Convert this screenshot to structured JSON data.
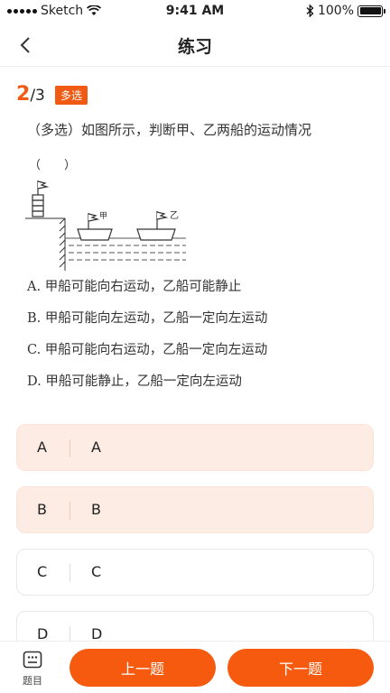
{
  "status_bar": {
    "carrier": "Sketch",
    "time": "9:41 AM",
    "battery": "100%"
  },
  "nav": {
    "title": "练习",
    "back_icon": "chevron-left-icon"
  },
  "question": {
    "current": "2",
    "separator": "/",
    "total": "3",
    "type_badge": "多选",
    "text": "（多选）如图所示，判断甲、乙两船的运动情况",
    "paren": "（　　）",
    "figure": {
      "boat_a_label": "甲",
      "boat_b_label": "乙"
    },
    "options": [
      "A.  甲船可能向右运动，乙船可能静止",
      "B.  甲船可能向左运动，乙船一定向左运动",
      "C.  甲船可能向右运动，乙船一定向左运动",
      "D.  甲船可能静止，乙船一定向左运动"
    ]
  },
  "answers": [
    {
      "letter": "A",
      "text": "A",
      "selected": true
    },
    {
      "letter": "B",
      "text": "B",
      "selected": true
    },
    {
      "letter": "C",
      "text": "C",
      "selected": false
    },
    {
      "letter": "D",
      "text": "D",
      "selected": false
    }
  ],
  "bottom": {
    "catalog_label": "题目",
    "prev_label": "上一题",
    "next_label": "下一题"
  },
  "colors": {
    "accent": "#f65a0e",
    "selected_bg": "#fdece4"
  }
}
